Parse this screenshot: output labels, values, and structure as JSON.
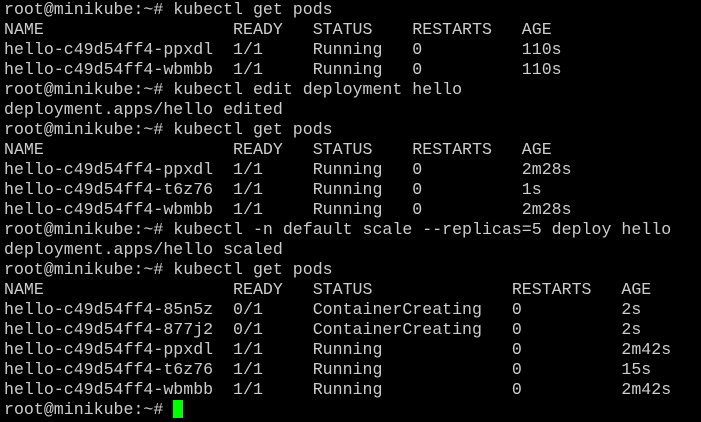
{
  "terminal": {
    "cursor_color": "#00ff00",
    "text_color": "#cccccc",
    "background_color": "#000000",
    "prompt": "root@minikube:~# ",
    "lines": [
      "root@minikube:~# kubectl get pods",
      "NAME                   READY   STATUS    RESTARTS   AGE",
      "hello-c49d54ff4-ppxdl  1/1     Running   0          110s",
      "hello-c49d54ff4-wbmbb  1/1     Running   0          110s",
      "root@minikube:~# kubectl edit deployment hello",
      "deployment.apps/hello edited",
      "root@minikube:~# kubectl get pods",
      "NAME                   READY   STATUS    RESTARTS   AGE",
      "hello-c49d54ff4-ppxdl  1/1     Running   0          2m28s",
      "hello-c49d54ff4-t6z76  1/1     Running   0          1s",
      "hello-c49d54ff4-wbmbb  1/1     Running   0          2m28s",
      "root@minikube:~# kubectl -n default scale --replicas=5 deploy hello",
      "deployment.apps/hello scaled",
      "root@minikube:~# kubectl get pods",
      "NAME                   READY   STATUS              RESTARTS   AGE",
      "hello-c49d54ff4-85n5z  0/1     ContainerCreating   0          2s",
      "hello-c49d54ff4-877j2  0/1     ContainerCreating   0          2s",
      "hello-c49d54ff4-ppxdl  1/1     Running             0          2m42s",
      "hello-c49d54ff4-t6z76  1/1     Running             0          15s",
      "hello-c49d54ff4-wbmbb  1/1     Running             0          2m42s"
    ]
  }
}
